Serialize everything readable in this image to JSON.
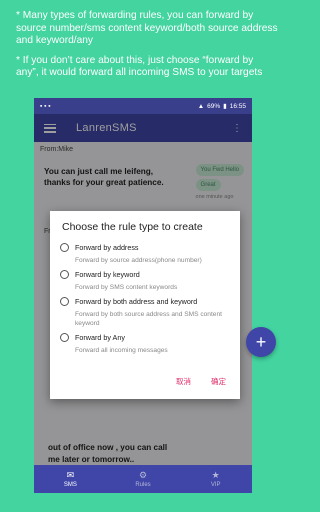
{
  "promo": {
    "line1": "* Many types of forwarding rules, you can forward by source number/sms content keyword/both source address and keyword/any",
    "line2": "* If you don’t care about this, just choose “forward by any”, it would forward all incoming SMS to your targets"
  },
  "status": {
    "battery": "69%",
    "time": "16:55"
  },
  "app": {
    "title": "LanrenSMS"
  },
  "messages": {
    "from_label": "From:Mike",
    "body": "You can just call me leifeng, thanks for your great patience.",
    "reply_chips": [
      "You Fwd Hello",
      "Great"
    ],
    "reply_time": "one minute ago",
    "from_label_2": "From:",
    "bottom_body": "out of office now , you can call me later or tomorrow.."
  },
  "dialog": {
    "title": "Choose the rule type to create",
    "options": [
      {
        "label": "Forward by address",
        "desc": "Forward by source address(phone number)"
      },
      {
        "label": "Forward by keyword",
        "desc": "Forward by SMS content keywords"
      },
      {
        "label": "Forward by both address and keyword",
        "desc": "Forward by both source address and SMS content keyword"
      },
      {
        "label": "Forward by Any",
        "desc": "Forward all incoming messages"
      }
    ],
    "cancel": "取消",
    "ok": "确定"
  },
  "nav": {
    "sms": "SMS",
    "rules": "Rules",
    "vip": "VIP"
  },
  "fab_symbol": "+"
}
